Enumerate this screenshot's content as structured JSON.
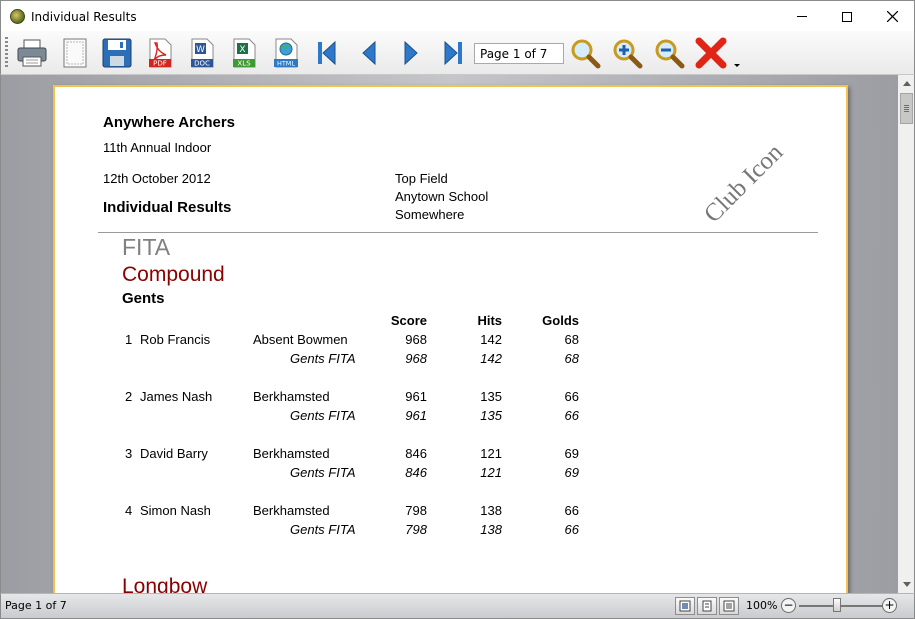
{
  "window": {
    "title": "Individual Results"
  },
  "toolbar": {
    "buttons": [
      "print-icon",
      "page-setup-icon",
      "save-icon",
      "pdf-icon",
      "doc-icon",
      "xls-icon",
      "html-icon",
      "first-page-icon",
      "previous-page-icon",
      "next-page-icon",
      "last-page-icon",
      "zoom-icon",
      "zoom-in-icon",
      "zoom-out-icon",
      "close-icon"
    ],
    "pdf_label": "PDF",
    "doc_label": "DOC",
    "xls_label": "XLS",
    "html_label": "HTML",
    "page_box": "Page 1 of 7"
  },
  "report": {
    "club": "Anywhere Archers",
    "event": "11th Annual Indoor",
    "date": "12th October 2012",
    "title": "Individual Results",
    "venue": [
      "Top Field",
      "Anytown School",
      "Somewhere"
    ],
    "watermark": "Club Icon",
    "round": "FITA",
    "division": "Compound",
    "gender": "Gents",
    "columns": [
      "Score",
      "Hits",
      "Golds"
    ],
    "archers": [
      {
        "rank": "1",
        "name": "Rob Francis",
        "club": "Absent Bowmen",
        "score": "968",
        "hits": "142",
        "golds": "68",
        "round_name": "Gents FITA",
        "r_score": "968",
        "r_hits": "142",
        "r_golds": "68"
      },
      {
        "rank": "2",
        "name": "James Nash",
        "club": "Berkhamsted",
        "score": "961",
        "hits": "135",
        "golds": "66",
        "round_name": "Gents FITA",
        "r_score": "961",
        "r_hits": "135",
        "r_golds": "66"
      },
      {
        "rank": "3",
        "name": "David Barry",
        "club": "Berkhamsted",
        "score": "846",
        "hits": "121",
        "golds": "69",
        "round_name": "Gents FITA",
        "r_score": "846",
        "r_hits": "121",
        "r_golds": "69"
      },
      {
        "rank": "4",
        "name": "Simon Nash",
        "club": "Berkhamsted",
        "score": "798",
        "hits": "138",
        "golds": "66",
        "round_name": "Gents FITA",
        "r_score": "798",
        "r_hits": "138",
        "r_golds": "66"
      }
    ],
    "next_division": "Longbow"
  },
  "status": {
    "page_text": "Page 1 of 7",
    "zoom": "100%",
    "zoom_level": 100
  },
  "colors": {
    "division": "#8b0000",
    "page_border": "#f2c14e",
    "viewer_bg": "#b1b3b7"
  }
}
